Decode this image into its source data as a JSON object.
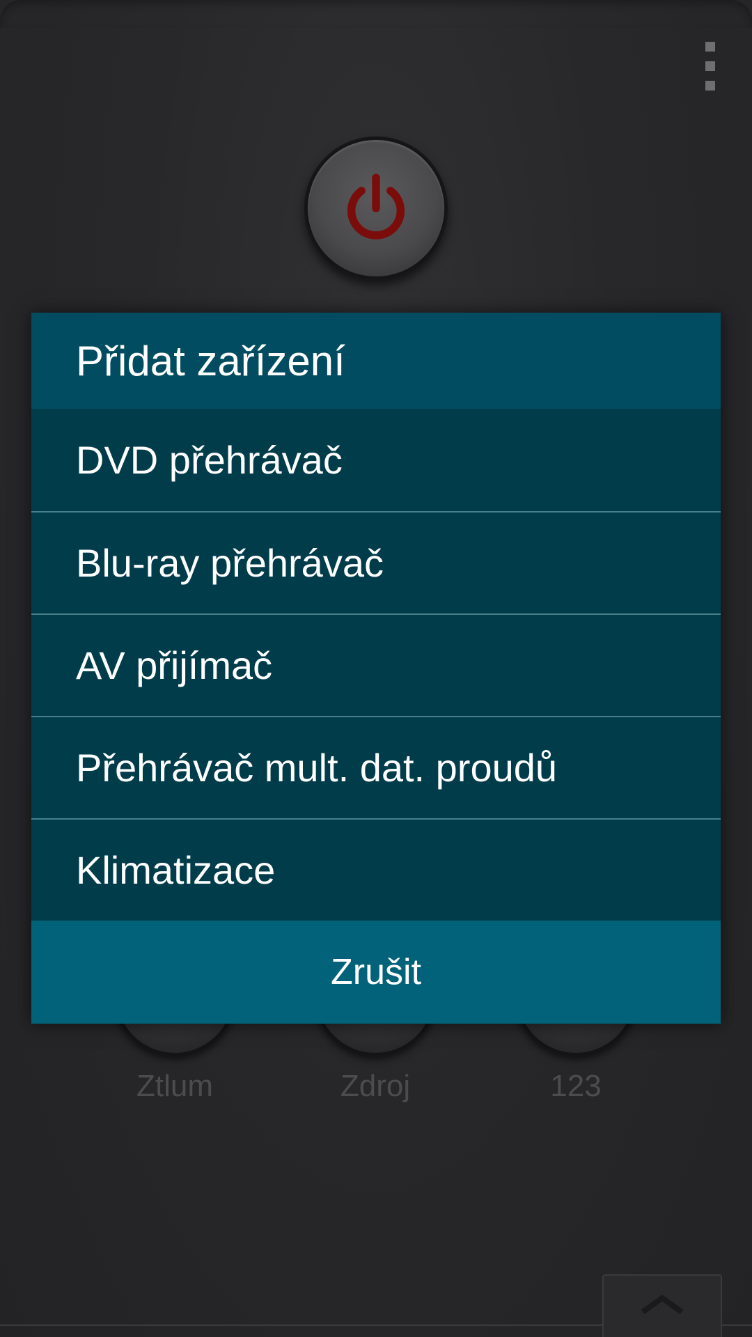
{
  "background": {
    "buttons": [
      {
        "label": "Ztlum"
      },
      {
        "label": "Zdroj"
      },
      {
        "label": "123"
      }
    ],
    "icons": {
      "power": "power-icon",
      "overflow": "overflow-menu-icon",
      "expand": "chevron-up-icon"
    },
    "colors": {
      "power_symbol": "#7a0c0c"
    }
  },
  "dialog": {
    "title": "Přidat zařízení",
    "items": [
      {
        "label": "DVD přehrávač"
      },
      {
        "label": "Blu-ray přehrávač"
      },
      {
        "label": "AV přijímač"
      },
      {
        "label": "Přehrávač mult. dat. proudů"
      },
      {
        "label": "Klimatizace"
      }
    ],
    "cancel_label": "Zrušit",
    "colors": {
      "title_bg": "#024c61",
      "list_bg": "#013c4b",
      "cancel_bg": "#02627a"
    }
  }
}
